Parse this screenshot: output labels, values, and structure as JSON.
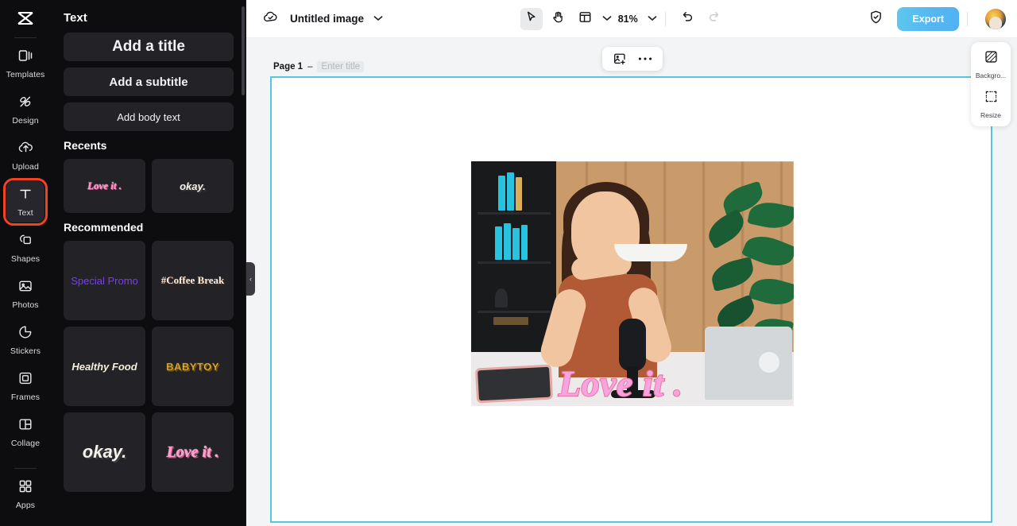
{
  "app": {
    "logo_icon": "capcut-logo-icon"
  },
  "rail": {
    "items": [
      {
        "label": "Templates",
        "icon": "templates-icon",
        "active": false
      },
      {
        "label": "Design",
        "icon": "design-icon",
        "active": false
      },
      {
        "label": "Upload",
        "icon": "upload-cloud-icon",
        "active": false
      },
      {
        "label": "Text",
        "icon": "text-icon",
        "active": true
      },
      {
        "label": "Shapes",
        "icon": "shapes-icon",
        "active": false
      },
      {
        "label": "Photos",
        "icon": "photos-icon",
        "active": false
      },
      {
        "label": "Stickers",
        "icon": "stickers-icon",
        "active": false
      },
      {
        "label": "Frames",
        "icon": "frames-icon",
        "active": false
      },
      {
        "label": "Collage",
        "icon": "collage-icon",
        "active": false
      },
      {
        "label": "Apps",
        "icon": "apps-icon",
        "active": false
      }
    ],
    "active_highlight_color": "#f4411f"
  },
  "panel": {
    "title": "Text",
    "buttons": [
      {
        "label": "Add a title"
      },
      {
        "label": "Add a subtitle"
      },
      {
        "label": "Add body text"
      }
    ],
    "recents_heading": "Recents",
    "recents": [
      {
        "label": "Love it .",
        "style": "st-loveit"
      },
      {
        "label": "okay.",
        "style": "st-okay"
      }
    ],
    "recommended_heading": "Recommended",
    "recommended": [
      {
        "label": "Special Promo",
        "style": "st-promo"
      },
      {
        "label": "#Coffee Break",
        "style": "st-coffee"
      },
      {
        "label": "Healthy Food",
        "style": "st-healthy"
      },
      {
        "label": "BABYTOY",
        "style": "st-baby"
      },
      {
        "label": "okay.",
        "style": "st-okay2"
      },
      {
        "label": "Love it .",
        "style": "st-loveit2"
      }
    ],
    "collapse_icon": "chevron-left-icon"
  },
  "topbar": {
    "cloud_icon": "cloud-saved-icon",
    "doc_title": "Untitled image",
    "title_chevron": "chevron-down-icon",
    "select_tool_icon": "cursor-select-icon",
    "hand_tool_icon": "hand-pan-icon",
    "layout_tool_icon": "layout-panel-icon",
    "layout_chevron": "chevron-down-icon",
    "zoom_level": "81%",
    "zoom_chevron": "chevron-down-icon",
    "undo_icon": "undo-icon",
    "redo_icon": "redo-icon",
    "shield_icon": "shield-check-icon",
    "export_label": "Export",
    "avatar_icon": "user-avatar",
    "export_color": "#55b8ef"
  },
  "canvas": {
    "page_label": "Page 1",
    "page_dash": "–",
    "title_placeholder": "Enter title",
    "float_tools": {
      "add_image_icon": "add-image-icon",
      "more_icon": "more-horizontal-icon"
    },
    "artboard_border_color": "#55c5e0",
    "overlay_text": "Love it ."
  },
  "right_dock": {
    "items": [
      {
        "label": "Backgro...",
        "icon": "background-icon"
      },
      {
        "label": "Resize",
        "icon": "resize-icon"
      }
    ]
  }
}
